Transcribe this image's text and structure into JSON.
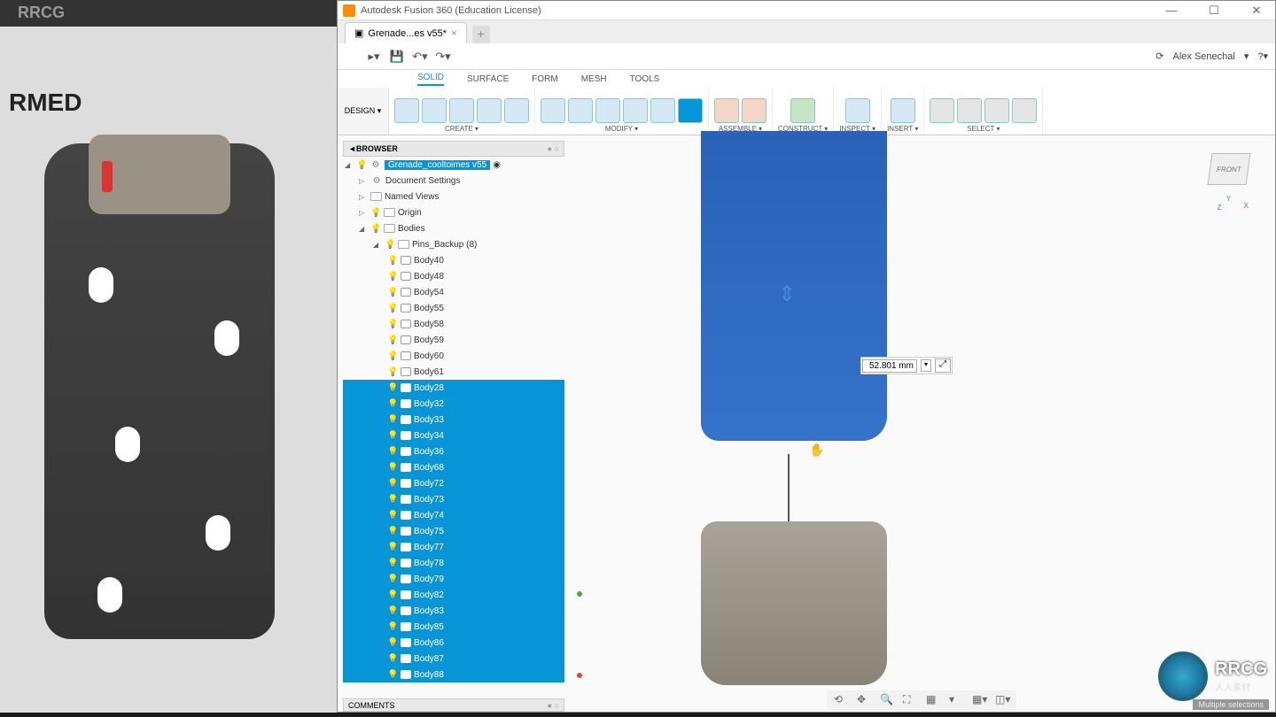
{
  "bg_ref": {
    "logo": "RRCG",
    "armed": "RMED"
  },
  "window": {
    "title": "Autodesk Fusion 360 (Education License)",
    "tab": "Grenade...es v55*",
    "user": "Alex Senechal"
  },
  "menu_tabs": [
    "SOLID",
    "SURFACE",
    "FORM",
    "MESH",
    "TOOLS"
  ],
  "ribbon": {
    "design": "DESIGN ▾",
    "groups": [
      {
        "label": "CREATE ▾",
        "icons": 5
      },
      {
        "label": "MODIFY ▾",
        "icons": 6
      },
      {
        "label": "ASSEMBLE ▾",
        "icons": 2
      },
      {
        "label": "CONSTRUCT ▾",
        "icons": 1
      },
      {
        "label": "INSPECT ▾",
        "icons": 1
      },
      {
        "label": "INSERT ▾",
        "icons": 1
      },
      {
        "label": "SELECT ▾",
        "icons": 4
      }
    ]
  },
  "browser": {
    "header": "BROWSER",
    "root": "Grenade_cooltoimes v55",
    "doc_settings": "Document Settings",
    "named_views": "Named Views",
    "origin": "Origin",
    "bodies": "Bodies",
    "pins_backup": "Pins_Backup (8)",
    "pins": [
      "Body40",
      "Body48",
      "Body54",
      "Body55",
      "Body58",
      "Body59",
      "Body60",
      "Body61"
    ],
    "selected_bodies": [
      "Body28",
      "Body32",
      "Body33",
      "Body34",
      "Body36",
      "Body68",
      "Body72",
      "Body73",
      "Body74",
      "Body75",
      "Body77",
      "Body78",
      "Body79",
      "Body82",
      "Body83",
      "Body85",
      "Body86",
      "Body87",
      "Body88"
    ]
  },
  "comments": "COMMENTS",
  "measurement": "52.801 mm",
  "viewcube": {
    "face": "FRONT"
  },
  "status": "Multiple selections",
  "wm": {
    "brand": "RRCG",
    "sub": "人人素材"
  }
}
